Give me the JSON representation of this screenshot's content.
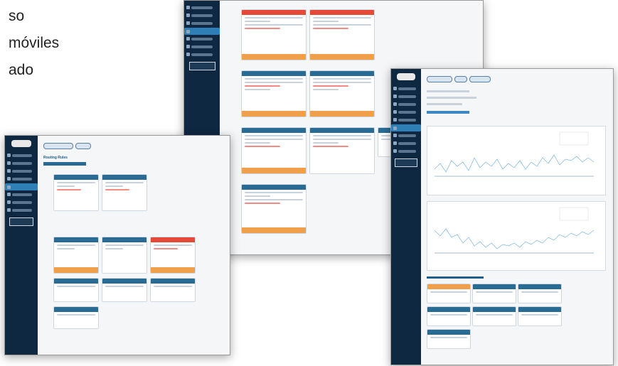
{
  "hero": {
    "lines": [
      "so",
      "móviles",
      "ado"
    ]
  },
  "screens": {
    "routing_rules": {
      "title": "Routing Rules"
    },
    "chart_screen": {
      "section_title": "Other Process Channels"
    }
  }
}
